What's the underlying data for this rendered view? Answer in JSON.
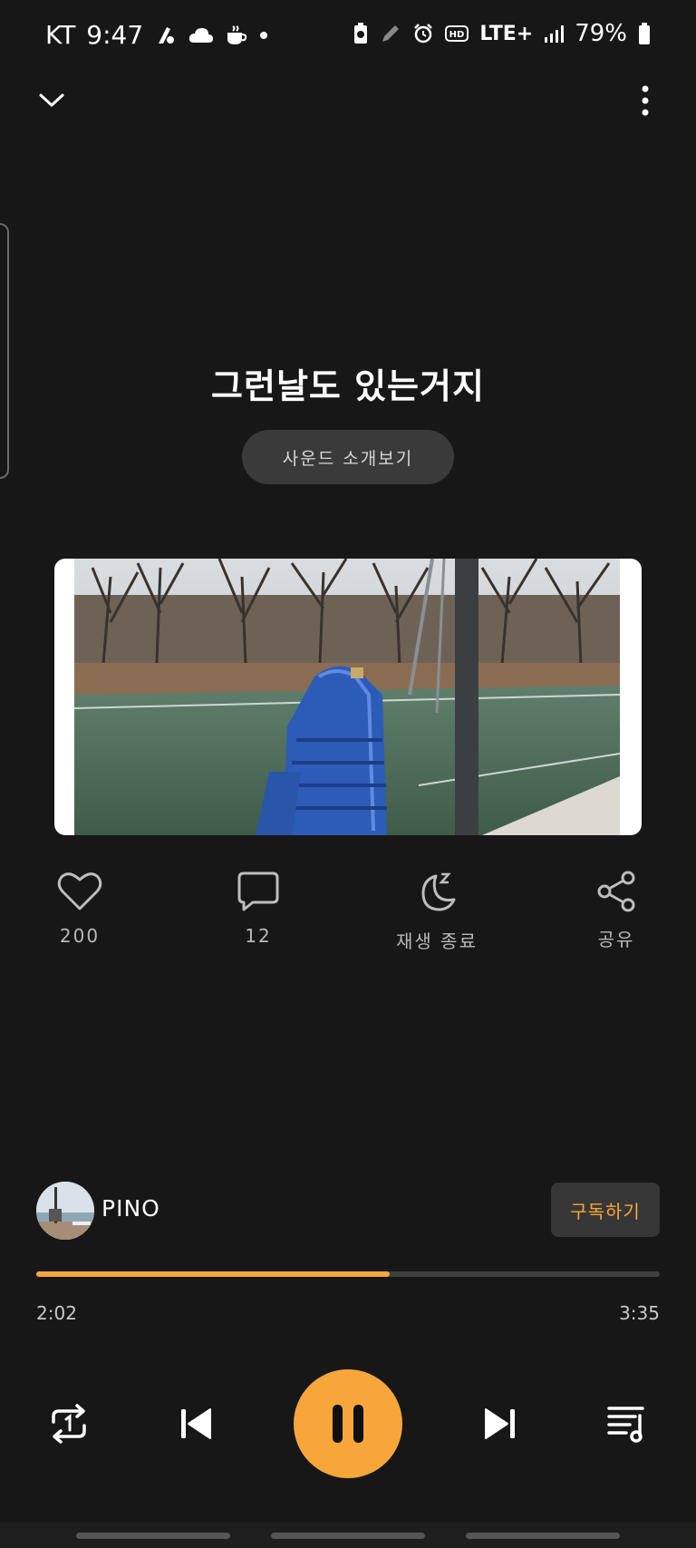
{
  "status_bar": {
    "carrier": "KT",
    "time": "9:47",
    "network": "LTE+",
    "battery": "79%"
  },
  "header": {
    "collapse_icon": "chevron-down-icon",
    "more_icon": "more-vertical-icon"
  },
  "track": {
    "title": "그런날도 있는거지",
    "intro_button_label": "사운드 소개보기"
  },
  "actions": {
    "likes": "200",
    "comments": "12",
    "sleep_timer_label": "재생 종료",
    "share_label": "공유"
  },
  "artist": {
    "name": "PINO",
    "subscribe_label": "구독하기"
  },
  "player": {
    "current_time": "2:02",
    "total_time": "3:35",
    "progress_percent": 56.7
  },
  "colors": {
    "accent": "#f7a739",
    "background": "#171717",
    "button_bg": "#3a3a3a"
  }
}
